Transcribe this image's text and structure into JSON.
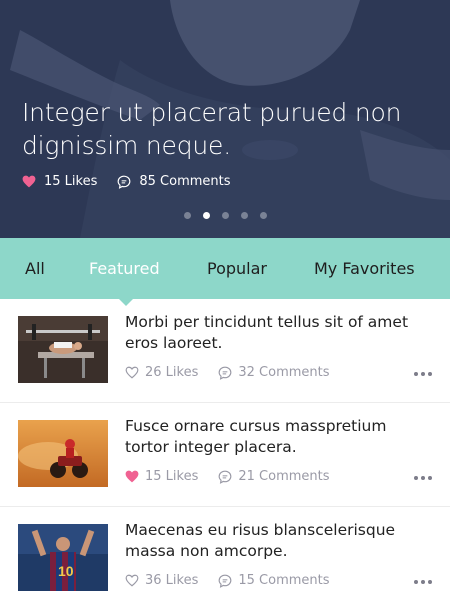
{
  "hero": {
    "title": "Integer ut placerat purued non dignissim neque.",
    "likes": "15 Likes",
    "comments": "85 Comments",
    "slides": 5,
    "active_slide": 2
  },
  "tabs": [
    {
      "label": "All",
      "active": false
    },
    {
      "label": "Featured",
      "active": true
    },
    {
      "label": "Popular",
      "active": false
    },
    {
      "label": "My Favorites",
      "active": false
    }
  ],
  "articles": [
    {
      "title": "Morbi per tincidunt tellus sit of amet eros laoreet.",
      "likes": "26 Likes",
      "comments": "32 Comments",
      "liked": false,
      "thumb": "gym-bench-press"
    },
    {
      "title": "Fusce ornare cursus masspretium tortor integer placera.",
      "likes": "15 Likes",
      "comments": "21 Comments",
      "liked": true,
      "thumb": "quad-bike-desert"
    },
    {
      "title": "Maecenas eu risus blanscelerisque massa non amcorpe.",
      "likes": "36 Likes",
      "comments": "15 Comments",
      "liked": false,
      "thumb": "football-player-10"
    }
  ],
  "colors": {
    "accent": "#8dd7c9",
    "heart": "#f06292",
    "hero_overlay": "#2b3652",
    "meta_gray": "#9a9aa6"
  }
}
